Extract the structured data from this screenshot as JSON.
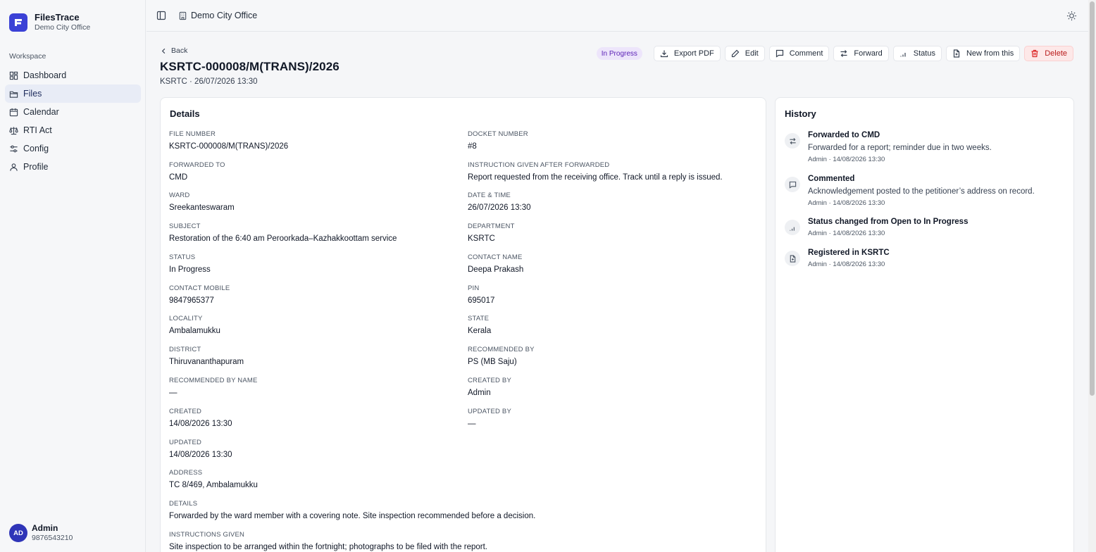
{
  "app": {
    "name": "FilesTrace",
    "org": "Demo City Office"
  },
  "sidebar": {
    "section_label": "Workspace",
    "items": [
      {
        "label": "Dashboard",
        "icon": "dashboard-icon",
        "active": false
      },
      {
        "label": "Files",
        "icon": "folder-icon",
        "active": true
      },
      {
        "label": "Calendar",
        "icon": "calendar-icon",
        "active": false
      },
      {
        "label": "RTI Act",
        "icon": "scales-icon",
        "active": false
      },
      {
        "label": "Config",
        "icon": "sliders-icon",
        "active": false
      },
      {
        "label": "Profile",
        "icon": "user-icon",
        "active": false
      }
    ],
    "user": {
      "initials": "AD",
      "name": "Admin",
      "phone": "9876543210"
    }
  },
  "topbar": {
    "office": "Demo City Office"
  },
  "page": {
    "back_label": "Back",
    "title": "KSRTC-000008/M(TRANS)/2026",
    "subtitle": "KSRTC · 26/07/2026 13:30",
    "status_badge": "In Progress"
  },
  "actions": {
    "export_pdf": "Export PDF",
    "edit": "Edit",
    "comment": "Comment",
    "forward": "Forward",
    "status": "Status",
    "new_from_this": "New from this",
    "delete": "Delete"
  },
  "details": {
    "title": "Details",
    "fields": [
      {
        "label": "File Number",
        "value": "KSRTC-000008/M(TRANS)/2026"
      },
      {
        "label": "Docket Number",
        "value": "#8"
      },
      {
        "label": "Forwarded To",
        "value": "CMD"
      },
      {
        "label": "Instruction Given After Forwarded",
        "value": "Report requested from the receiving office. Track until a reply is issued."
      },
      {
        "label": "Ward",
        "value": "Sreekanteswaram"
      },
      {
        "label": "Date & Time",
        "value": "26/07/2026 13:30"
      },
      {
        "label": "Subject",
        "value": "Restoration of the 6:40 am Peroorkada–Kazhakkoottam service"
      },
      {
        "label": "Department",
        "value": "KSRTC"
      },
      {
        "label": "Status",
        "value": "In Progress"
      },
      {
        "label": "Contact Name",
        "value": "Deepa Prakash"
      },
      {
        "label": "Contact Mobile",
        "value": "9847965377"
      },
      {
        "label": "PIN",
        "value": "695017"
      },
      {
        "label": "Locality",
        "value": "Ambalamukku"
      },
      {
        "label": "State",
        "value": "Kerala"
      },
      {
        "label": "District",
        "value": "Thiruvananthapuram"
      },
      {
        "label": "Recommended By",
        "value": "PS (MB Saju)"
      },
      {
        "label": "Recommended By Name",
        "value": "—"
      },
      {
        "label": "Created By",
        "value": "Admin"
      },
      {
        "label": "Created",
        "value": "14/08/2026 13:30"
      },
      {
        "label": "Updated By",
        "value": "—"
      },
      {
        "label": "Updated",
        "value": "14/08/2026 13:30"
      },
      {
        "label": "Address",
        "value": "TC 8/469, Ambalamukku"
      },
      {
        "label": "Details",
        "value": "Forwarded by the ward member with a covering note. Site inspection recommended before a decision."
      },
      {
        "label": "Instructions Given",
        "value": "Site inspection to be arranged within the fortnight; photographs to be filed with the report."
      }
    ]
  },
  "history": {
    "title": "History",
    "items": [
      {
        "icon": "forward-arrows-icon",
        "title": "Forwarded to CMD",
        "note": "Forwarded for a report; reminder due in two weeks.",
        "meta": "Admin · 14/08/2026 13:30"
      },
      {
        "icon": "comment-icon",
        "title": "Commented",
        "note": "Acknowledgement posted to the petitioner’s address on record.",
        "meta": "Admin · 14/08/2026 13:30"
      },
      {
        "icon": "status-bars-icon",
        "title": "Status changed from Open to In Progress",
        "note": "",
        "meta": "Admin · 14/08/2026 13:30"
      },
      {
        "icon": "file-plus-icon",
        "title": "Registered in KSRTC",
        "note": "",
        "meta": "Admin · 14/08/2026 13:30"
      }
    ]
  }
}
